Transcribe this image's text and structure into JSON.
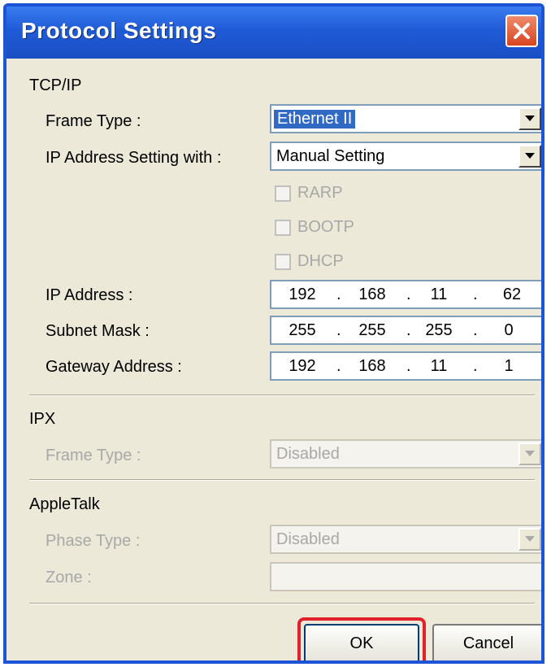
{
  "window": {
    "title": "Protocol Settings"
  },
  "tcpip": {
    "group_label": "TCP/IP",
    "frame_type_label": "Frame Type :",
    "frame_type_value": "Ethernet II",
    "ip_setting_label": "IP Address Setting with :",
    "ip_setting_value": "Manual Setting",
    "checkboxes": [
      {
        "label": "RARP",
        "checked": false,
        "enabled": false
      },
      {
        "label": "BOOTP",
        "checked": false,
        "enabled": false
      },
      {
        "label": "DHCP",
        "checked": false,
        "enabled": false
      }
    ],
    "ip_address_label": "IP Address :",
    "ip_address": [
      "192",
      "168",
      "11",
      "62"
    ],
    "subnet_mask_label": "Subnet Mask :",
    "subnet_mask": [
      "255",
      "255",
      "255",
      "0"
    ],
    "gateway_label": "Gateway Address :",
    "gateway": [
      "192",
      "168",
      "11",
      "1"
    ],
    "ip_separator": "."
  },
  "ipx": {
    "group_label": "IPX",
    "frame_type_label": "Frame Type :",
    "frame_type_value": "Disabled"
  },
  "appletalk": {
    "group_label": "AppleTalk",
    "phase_type_label": "Phase Type :",
    "phase_type_value": "Disabled",
    "zone_label": "Zone :",
    "zone_value": ""
  },
  "buttons": {
    "ok": "OK",
    "cancel": "Cancel"
  },
  "colors": {
    "titlebar": "#1f5bd6",
    "highlight": "#e0202a",
    "selection": "#316ac5"
  },
  "icons": {
    "close": "close-icon",
    "dropdown": "chevron-down-icon"
  }
}
